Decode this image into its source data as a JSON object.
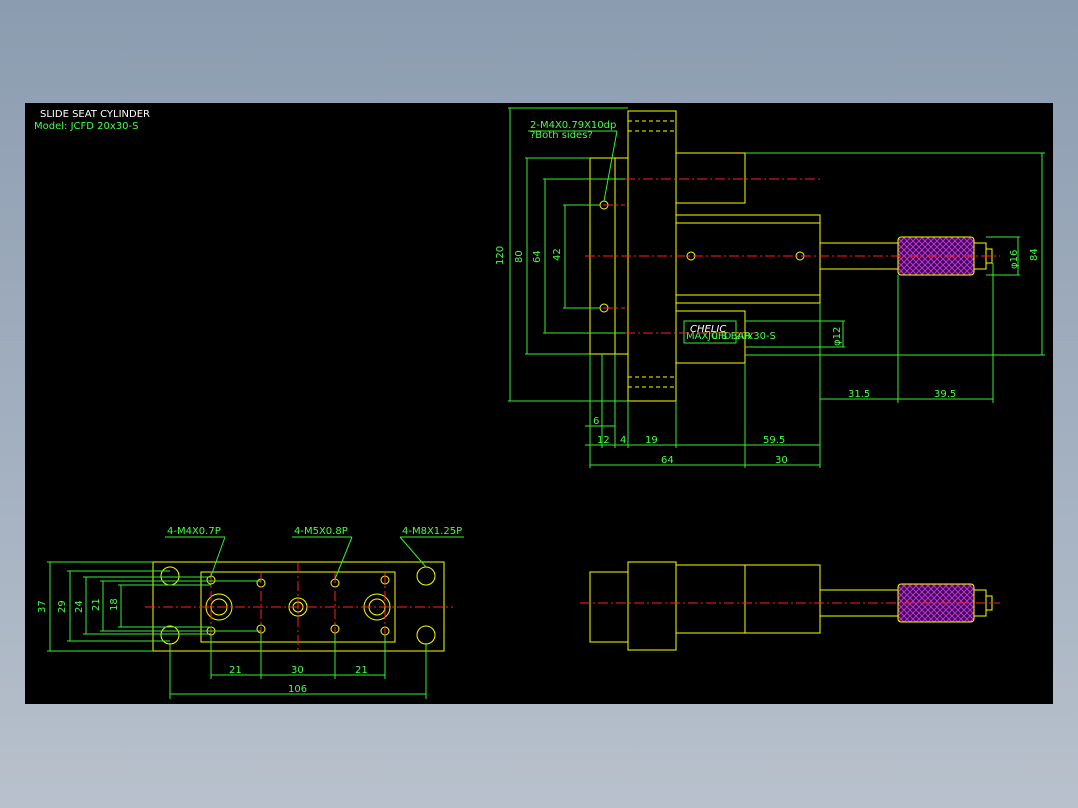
{
  "title_block": {
    "title": "SLIDE SEAT CYLINDER",
    "model": "Model: JCFD 20x30-S"
  },
  "callouts": {
    "thread_2": "2-M4X0.79X10dp",
    "both_sides": "?Both sides?",
    "thread_m4": "4-M4X0.7P",
    "thread_m5": "4-M5X0.8P",
    "thread_m8": "4-M8X1.25P"
  },
  "brand_label": {
    "brand": "CHELIC",
    "line1": "MAX 0.8 BAR",
    "line2": "JCFD 20x30-S"
  },
  "dims_side": {
    "h120": "120",
    "h80": "80",
    "h64": "64",
    "h42": "42",
    "h84": "84",
    "d16": "φ16",
    "d12": "φ12",
    "w31_5": "31.5",
    "w39_5": "39.5",
    "w6": "6",
    "w12": "12",
    "w4": "4",
    "w19": "19",
    "w59_5": "59.5",
    "w64": "64",
    "w30": "30"
  },
  "dims_bottom": {
    "h37": "37",
    "h29": "29",
    "h24": "24",
    "h21": "21",
    "h18": "18",
    "w21a": "21",
    "w30": "30",
    "w21b": "21",
    "w106": "106"
  },
  "colors": {
    "background": "#000000",
    "outline": "#ffff00",
    "dimension": "#33ee33",
    "centerline": "#ff2020",
    "text": "#ffffff",
    "knurl": "#aa22cc"
  }
}
